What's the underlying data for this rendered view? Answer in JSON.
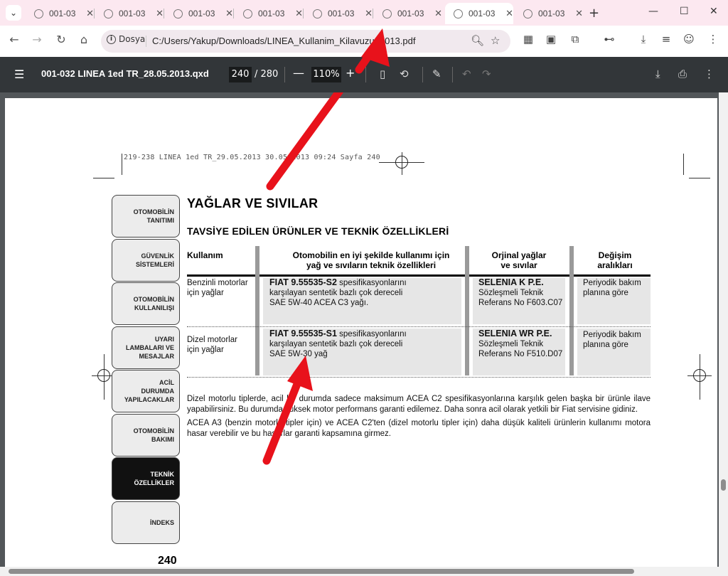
{
  "browser": {
    "tabs": [
      {
        "label": "001-03"
      },
      {
        "label": "001-03"
      },
      {
        "label": "001-03"
      },
      {
        "label": "001-03"
      },
      {
        "label": "001-03"
      },
      {
        "label": "001-03"
      },
      {
        "label": "001-03"
      },
      {
        "label": "001-03"
      }
    ],
    "omnibox": {
      "site_label": "Dosya",
      "url": "C:/Users/Yakup/Downloads/LINEA_Kullanim_Kilavuzu_2013.pdf"
    }
  },
  "pdf_toolbar": {
    "title": "001-032 LINEA 1ed TR_28.05.2013.qxd",
    "current_page": "240",
    "total_pages": "/ 280",
    "zoom": "110%"
  },
  "document": {
    "running_head": "219-238 LINEA 1ed TR_29.05.2013  30.05.2013  09:24  Sayfa 240",
    "side_tabs": [
      {
        "label": "OTOMOBİLİN\nTANITIMI"
      },
      {
        "label": "GÜVENLİK\nSİSTEMLERİ"
      },
      {
        "label": "OTOMOBİLİN\nKULLANILIŞI"
      },
      {
        "label": "UYARI\nLAMBALARI VE\nMESAJLAR"
      },
      {
        "label": "ACİL\nDURUMDA\nYAPILACAKLAR"
      },
      {
        "label": "OTOMOBİLİN\nBAKIMI"
      },
      {
        "label": "TEKNİK\nÖZELLİKLER"
      },
      {
        "label": "İNDEKS"
      }
    ],
    "page_number": "240",
    "heading": "YAĞLAR VE SIVILAR",
    "subheading": "TAVSİYE EDİLEN ÜRÜNLER VE TEKNİK ÖZELLİKLERİ",
    "table": {
      "headers": {
        "usage": "Kullanım",
        "spec": "Otomobilin en iyi şekilde kullanımı için\nyağ ve sıvıların teknik özellikleri",
        "original": "Orjinal yağlar\nve sıvılar",
        "interval": "Değişim\naralıkları"
      },
      "rows": [
        {
          "usage": "Benzinli motorlar\niçin yağlar",
          "spec_code": "FIAT 9.55535-S2",
          "spec_text_1": " spesifikasyonlarını",
          "spec_text_2": "karşılayan sentetik bazlı çok dereceli\nSAE 5W-40 ACEA C3 yağı.",
          "original_name": "SELENIA K P.E.",
          "original_text": "Sözleşmeli Teknik\nReferans No F603.C07",
          "interval": "Periyodik bakım\nplanına göre"
        },
        {
          "usage": "Dizel motorlar\niçin yağlar",
          "spec_code": "FIAT 9.55535-S1",
          "spec_text_1": " spesifikasyonlarını",
          "spec_text_2": "karşılayan sentetik bazlı çok dereceli\nSAE 5W-30 yağ",
          "original_name": "SELENIA WR P.E.",
          "original_text": "Sözleşmeli Teknik\nReferans No F510.D07",
          "interval": "Periyodik bakım\nplanına göre"
        }
      ]
    },
    "paragraph_1": "Dizel motorlu tiplerde, acil bir durumda sadece maksimum ACEA C2 spesifikasyonlarına karşılık gelen başka bir ürünle ilave yapabilirsiniz. Bu durumda yüksek motor performans garanti edilemez. Daha sonra acil olarak yetkili bir Fiat servisine gidiniz.",
    "paragraph_2": "ACEA A3 (benzin motorlu tipler için) ve ACEA C2'ten (dizel motorlu tipler için) daha düşük kaliteli ürünlerin kullanımı motora hasar verebilir ve bu hasarlar garanti kapsamına girmez."
  },
  "annotation_colors": {
    "arrow": "#e8121b"
  }
}
